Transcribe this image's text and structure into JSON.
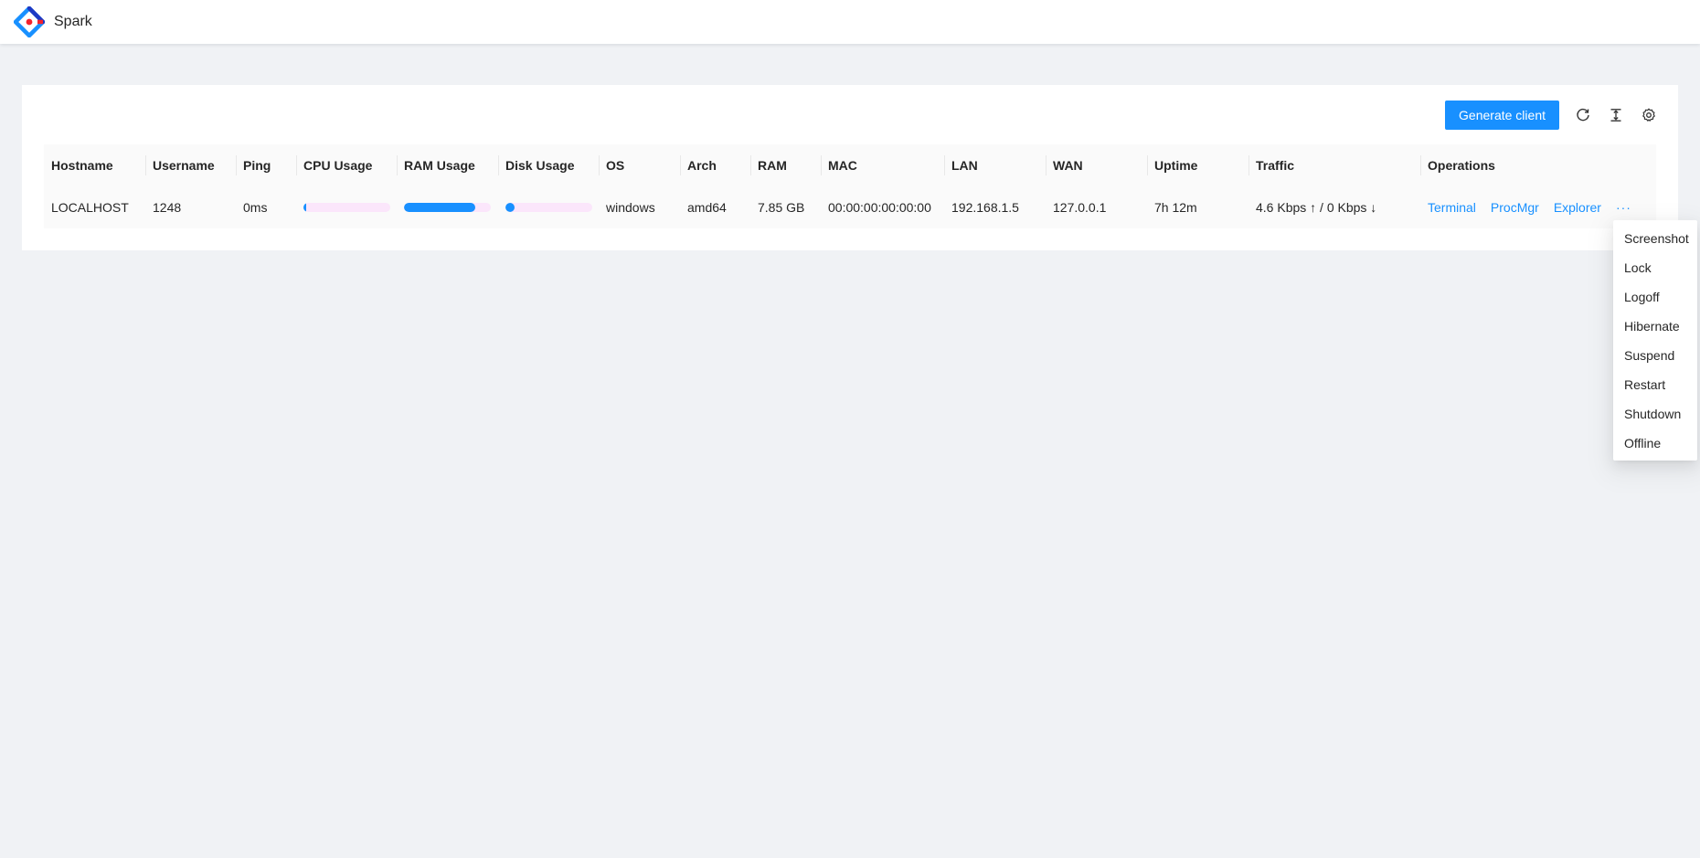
{
  "app": {
    "brand": "Spark",
    "accent": "#1890ff"
  },
  "toolbar": {
    "generate_label": "Generate client",
    "icons": [
      "reload-icon",
      "column-height-icon",
      "settings-icon"
    ]
  },
  "table": {
    "columns": [
      "Hostname",
      "Username",
      "Ping",
      "CPU Usage",
      "RAM Usage",
      "Disk Usage",
      "OS",
      "Arch",
      "RAM",
      "MAC",
      "LAN",
      "WAN",
      "Uptime",
      "Traffic",
      "Operations"
    ],
    "rows": [
      {
        "hostname": "LOCALHOST",
        "username": "1248",
        "ping": "0ms",
        "cpu_usage": 0.03,
        "ram_usage": 0.82,
        "disk_usage": 0.1,
        "os": "windows",
        "arch": "amd64",
        "ram": "7.85 GB",
        "mac": "00:00:00:00:00:00",
        "lan": "192.168.1.5",
        "wan": "127.0.0.1",
        "uptime": "7h 12m",
        "traffic": "4.6 Kbps ↑ / 0 Kbps ↓",
        "operations": [
          "Terminal",
          "ProcMgr",
          "Explorer"
        ],
        "more": "···"
      }
    ]
  },
  "menu": {
    "items": [
      "Screenshot",
      "Lock",
      "Logoff",
      "Hibernate",
      "Suspend",
      "Restart",
      "Shutdown",
      "Offline"
    ]
  }
}
